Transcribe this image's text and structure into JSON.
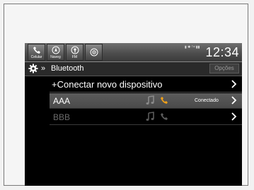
{
  "statusbar": {
    "buttons": [
      {
        "label": "Celular",
        "icon": "phone-icon"
      },
      {
        "label": "Naveg",
        "icon": "navigation-icon"
      },
      {
        "label": "FM",
        "icon": "radio-icon"
      },
      {
        "label": "",
        "icon": "audio-source-icon"
      }
    ],
    "mini": "▮ ✱ ᵀᵃˡ ▮▮",
    "time": "12:34"
  },
  "titlebar": {
    "arrows": "»",
    "title": "Bluetooth",
    "options_label": "Opções"
  },
  "list": {
    "add_label": "+Conectar novo dispositivo",
    "devices": [
      {
        "name": "AAA",
        "status": "Conectado",
        "active": true
      },
      {
        "name": "BBB",
        "status": "",
        "active": false
      }
    ]
  },
  "colors": {
    "screen_bg": "#000000",
    "active_row": "#4f4f4f",
    "phone_icon_active": "#f0a018",
    "icon_inactive": "#5a5a5a"
  }
}
